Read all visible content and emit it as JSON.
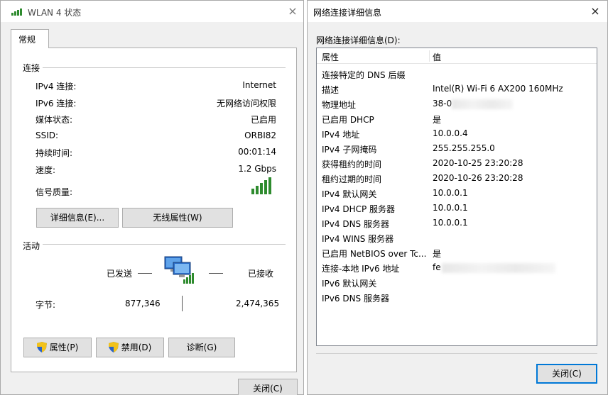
{
  "status_window": {
    "title": "WLAN 4 状态",
    "close_glyph": "×",
    "tab_general": "常规",
    "connection": {
      "heading": "连接",
      "rows": [
        {
          "label": "IPv4 连接:",
          "value": "Internet"
        },
        {
          "label": "IPv6 连接:",
          "value": "无网络访问权限"
        },
        {
          "label": "媒体状态:",
          "value": "已启用"
        },
        {
          "label": "SSID:",
          "value": "ORBI82"
        },
        {
          "label": "持续时间:",
          "value": "00:01:14"
        },
        {
          "label": "速度:",
          "value": "1.2 Gbps"
        }
      ],
      "signal_label": "信号质量:",
      "signal_bars_lit": 5,
      "details_button": "详细信息(E)...",
      "wireless_props_button": "无线属性(W)"
    },
    "activity": {
      "heading": "活动",
      "sent_label": "已发送",
      "received_label": "已接收",
      "bytes_label": "字节:",
      "bytes_sent": "877,346",
      "bytes_received": "2,474,365"
    },
    "buttons": {
      "properties": "属性(P)",
      "disable": "禁用(D)",
      "diagnose": "诊断(G)",
      "close": "关闭(C)"
    }
  },
  "details_window": {
    "title": "网络连接详细信息",
    "close_glyph": "×",
    "list_label": "网络连接详细信息(D):",
    "columns": {
      "property": "属性",
      "value": "值"
    },
    "rows": [
      {
        "property": "连接特定的 DNS 后缀",
        "value": ""
      },
      {
        "property": "描述",
        "value": "Intel(R) Wi-Fi 6 AX200 160MHz"
      },
      {
        "property": "物理地址",
        "value": "38-0"
      },
      {
        "property": "已启用 DHCP",
        "value": "是"
      },
      {
        "property": "IPv4 地址",
        "value": "10.0.0.4"
      },
      {
        "property": "IPv4 子网掩码",
        "value": "255.255.255.0"
      },
      {
        "property": "获得租约的时间",
        "value": "2020-10-25 23:20:28"
      },
      {
        "property": "租约过期的时间",
        "value": "2020-10-26 23:20:28"
      },
      {
        "property": "IPv4 默认网关",
        "value": "10.0.0.1"
      },
      {
        "property": "IPv4 DHCP 服务器",
        "value": "10.0.0.1"
      },
      {
        "property": "IPv4 DNS 服务器",
        "value": "10.0.0.1"
      },
      {
        "property": "IPv4 WINS 服务器",
        "value": ""
      },
      {
        "property": "已启用 NetBIOS over Tc...",
        "value": "是"
      },
      {
        "property": "连接-本地 IPv6 地址",
        "value": "fe"
      },
      {
        "property": "IPv6 默认网关",
        "value": ""
      },
      {
        "property": "IPv6 DNS 服务器",
        "value": ""
      }
    ],
    "close_button": "关闭(C)"
  },
  "colors": {
    "window_bg": "#f0f0f0",
    "button_bg": "#e1e1e1",
    "signal_green": "#2e8b2e",
    "focus_blue": "#0078d7"
  }
}
